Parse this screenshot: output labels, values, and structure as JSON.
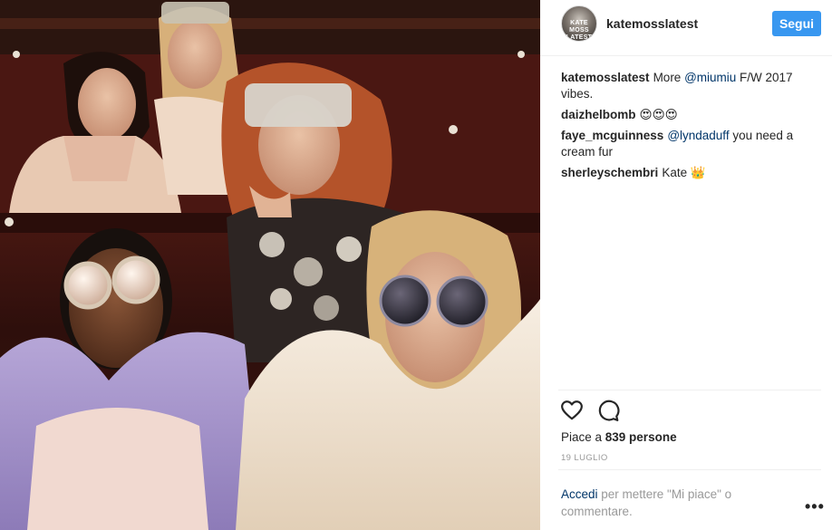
{
  "post": {
    "username": "katemosslatest",
    "avatar_text": "KATE MOSS LATEST",
    "follow_label": "Segui"
  },
  "comments": [
    {
      "user": "katemosslatest",
      "text_before": "More ",
      "tag": "@miumiu",
      "text_after": " F/W 2017 vibes."
    },
    {
      "user": "daizhelbomb",
      "text": "😍😍😍"
    },
    {
      "user": "faye_mcguinness",
      "tag": "@lyndaduff",
      "text_after": " you need a cream fur"
    },
    {
      "user": "sherleyschembri",
      "text": "Kate 👑"
    }
  ],
  "actions": {
    "like_icon": "heart-icon",
    "comment_icon": "comment-icon"
  },
  "likes": {
    "prefix": "Piace a ",
    "count": "839 persone"
  },
  "date": "19 LUGLIO",
  "login_prompt": {
    "link": "Accedi",
    "text": " per mettere \"Mi piace\" o commentare."
  },
  "more_label": "•••",
  "colors": {
    "accent": "#3897f0",
    "link": "#003569",
    "muted": "#999999",
    "text": "#262626"
  }
}
